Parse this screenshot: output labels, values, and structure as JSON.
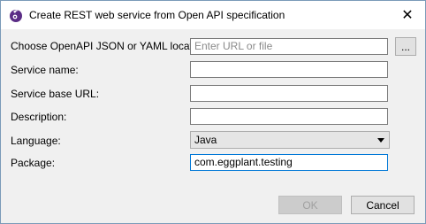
{
  "window": {
    "title": "Create REST web service from Open API specification",
    "close_symbol": "✕"
  },
  "form": {
    "location_label": "Choose OpenAPI JSON or YAML location:",
    "location_placeholder": "Enter URL or file",
    "location_value": "",
    "browse_label": "...",
    "service_name_label": "Service name:",
    "service_name_value": "",
    "base_url_label": "Service base URL:",
    "base_url_value": "",
    "description_label": "Description:",
    "description_value": "",
    "language_label": "Language:",
    "language_value": "Java",
    "package_label": "Package:",
    "package_value": "com.eggplant.testing"
  },
  "buttons": {
    "ok_label": "OK",
    "ok_enabled": false,
    "cancel_label": "Cancel"
  },
  "colors": {
    "dialog_bg": "#f0f0f0",
    "titlebar_bg": "#ffffff",
    "focus_border": "#0078d7",
    "icon_purple": "#5b2d86"
  },
  "icons": {
    "app": "eggplant-logo-icon",
    "close": "close-icon",
    "dropdown": "chevron-down-icon"
  }
}
